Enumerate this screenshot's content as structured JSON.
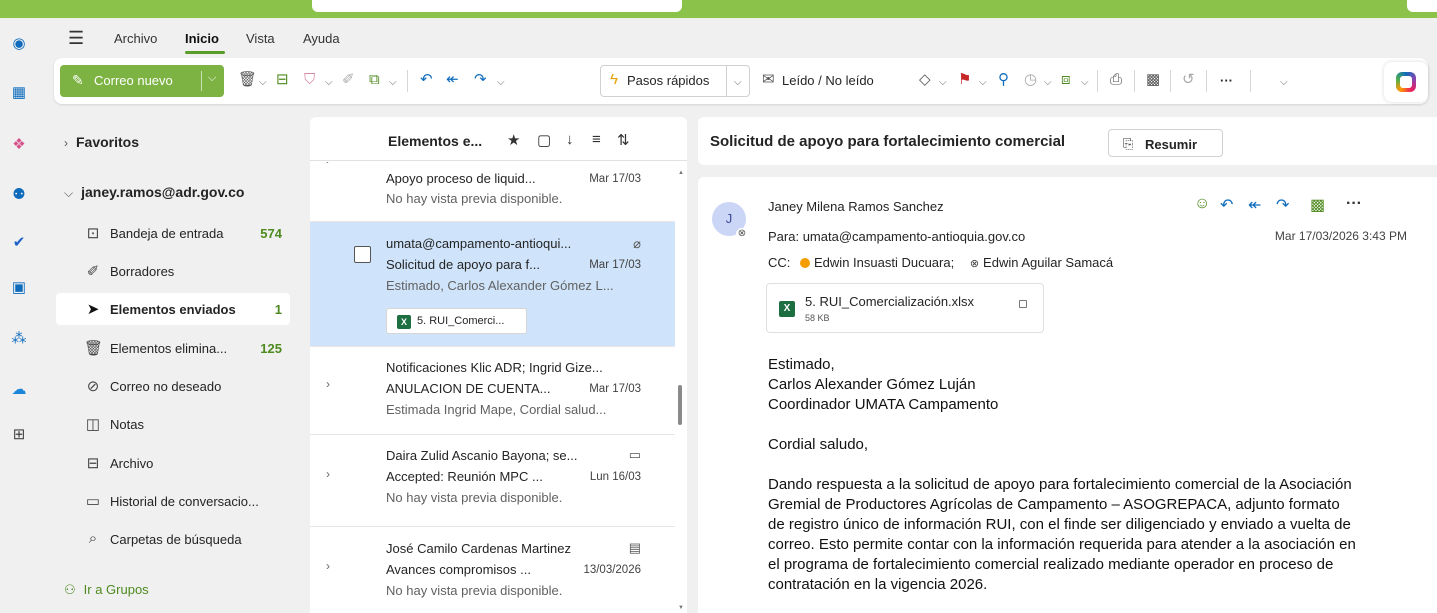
{
  "menu": {
    "items": [
      "Archivo",
      "Inicio",
      "Vista",
      "Ayuda"
    ],
    "active": "Inicio"
  },
  "ribbon": {
    "new_mail": "Correo nuevo",
    "pasos_rapidos": "Pasos rápidos",
    "leido_no_leido": "Leído / No leído",
    "more": "···"
  },
  "folders": {
    "favoritos": "Favoritos",
    "account": "janey.ramos@adr.gov.co",
    "items": [
      {
        "label": "Bandeja de entrada",
        "count": "574",
        "icon": "inbox-icon"
      },
      {
        "label": "Borradores",
        "count": "",
        "icon": "draft-icon"
      },
      {
        "label": "Elementos enviados",
        "count": "1",
        "icon": "sent-icon"
      },
      {
        "label": "Elementos elimina...",
        "count": "125",
        "icon": "trash-icon"
      },
      {
        "label": "Correo no deseado",
        "count": "",
        "icon": "junk-icon"
      },
      {
        "label": "Notas",
        "count": "",
        "icon": "notes-icon"
      },
      {
        "label": "Archivo",
        "count": "",
        "icon": "archive-icon"
      },
      {
        "label": "Historial de conversacio...",
        "count": "",
        "icon": "history-folder-icon"
      },
      {
        "label": "Carpetas de búsqueda",
        "count": "",
        "icon": "search-folder-icon"
      }
    ],
    "selected_index": 2,
    "grupos": "Ir a Grupos"
  },
  "list": {
    "title": "Elementos e...",
    "messages": [
      {
        "sender": "",
        "subject": "Apoyo proceso de liquid...",
        "date": "Mar 17/03",
        "preview": "No hay vista previa disponible."
      },
      {
        "sender": "umata@campamento-antioqui...",
        "subject": "Solicitud de apoyo para f...",
        "date": "Mar 17/03",
        "preview": "Estimado, Carlos Alexander Gómez L...",
        "attachment": "5. RUI_Comerci..."
      },
      {
        "sender": "Notificaciones Klic ADR; Ingrid Gize...",
        "subject": "ANULACION DE CUENTA...",
        "date": "Mar 17/03",
        "preview": "Estimada Ingrid Mape, Cordial salud..."
      },
      {
        "sender": "Daira Zulid Ascanio Bayona; se...",
        "subject": "Accepted: Reunión MPC ...",
        "date": "Lun 16/03",
        "preview": "No hay vista previa disponible."
      },
      {
        "sender": "José Camilo Cardenas Martinez",
        "subject": "Avances compromisos ...",
        "date": "13/03/2026",
        "preview": "No hay vista previa disponible."
      }
    ]
  },
  "reading": {
    "subject": "Solicitud de apoyo para fortalecimiento comercial",
    "summarize": "Resumir",
    "avatar_initial": "J",
    "sender": "Janey Milena Ramos Sanchez",
    "to_label": "Para:",
    "to": "umata@campamento-antioquia.gov.co",
    "date": "Mar 17/03/2026 3:43 PM",
    "cc_label": "CC:",
    "cc1": "Edwin Insuasti Ducuara;",
    "cc2": "Edwin Aguilar Samacá",
    "attachment_name": "5. RUI_Comercialización.xlsx",
    "attachment_size": "58 KB",
    "body": {
      "greeting1": "Estimado,",
      "greeting2": "Carlos Alexander Gómez Luján",
      "greeting3": "Coordinador UMATA Campamento",
      "salute": "Cordial saludo,",
      "paragraph": "Dando respuesta a la solicitud de apoyo para fortalecimiento comercial de la Asociación Gremial de Productores Agrícolas de Campamento – ASOGREPACA, adjunto formato de registro único de información RUI, con el finde ser diligenciado y enviado a vuelta de correo. Esto permite contar con la información requerida para atender a la asociación en el programa de fortalecimiento comercial realizado mediante operador  en proceso de contratación en la vigencia 2026."
    }
  },
  "colors": {
    "accent": "#7cb342",
    "selected_row": "#cfe4fa",
    "count_green": "#4e8a1f"
  }
}
